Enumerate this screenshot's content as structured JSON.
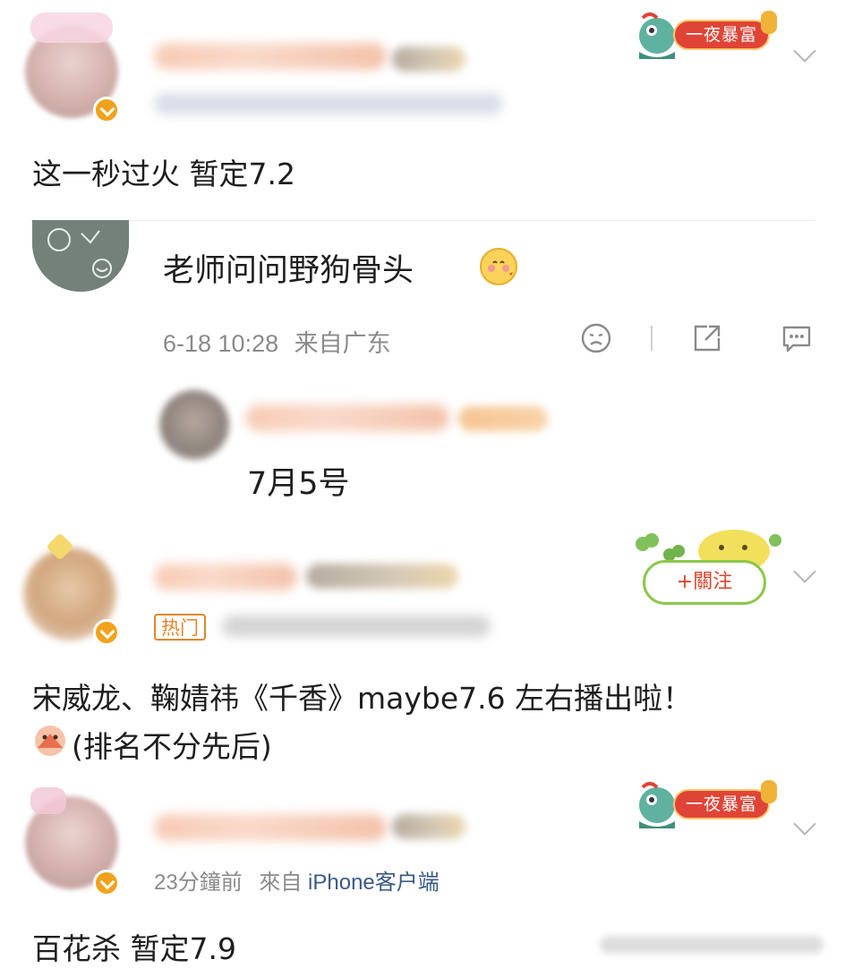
{
  "posts": [
    {
      "badge_text": "一夜暴富",
      "content": "这一秒过火 暂定7.2",
      "reply": {
        "content": "老师问问野狗骨头",
        "emoji": "shy-face-emoji",
        "time": "6-18 10:28",
        "source": "来自广东",
        "sub_reply": {
          "content": "7月5号"
        }
      }
    },
    {
      "tag": "热门",
      "follow_label": "+關注",
      "content_line1": "宋威龙、鞠婧祎《千香》maybe7.6 左右播出啦！",
      "content_line2": "(排名不分先后)"
    },
    {
      "badge_text": "一夜暴富",
      "time": "23分鐘前",
      "source_prefix": "來自",
      "client": "iPhone客户端",
      "content": "百花杀 暂定7.9"
    }
  ],
  "colors": {
    "accent_blue": "#3a5a86",
    "badge_red": "#e04436",
    "hot_orange": "#e0862c",
    "follow_green": "#8cc84a"
  }
}
